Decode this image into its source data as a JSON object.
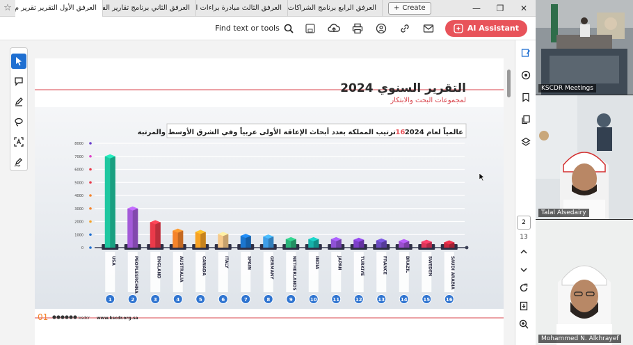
{
  "tabs": [
    {
      "label": "العرفق الأول التقرير تقرير م..",
      "active": true
    },
    {
      "label": "العرفق الثاني برنامج تقارير الفجوات..",
      "active": false
    },
    {
      "label": "العرفق الثالث مبادرة براءات الاخترا..",
      "active": false
    },
    {
      "label": "العرفق الرابع برنامج الشراكات العا..",
      "active": false
    }
  ],
  "create_label": "Create",
  "toolbar": {
    "find_label": "Find text or tools",
    "ai_label": "AI Assistant"
  },
  "page_control": {
    "current": "2",
    "total": "13"
  },
  "report": {
    "title": "التقرير السنوي 2024",
    "subtitle": "لمجموعات البحث والابتكار",
    "chart_heading": "ترتيب المملكة بعدد أبحاث الإعاقة الأولى عربياً وفي الشرق الأوسط والمرتبة",
    "rank_highlight": "16",
    "heading_suffix": "عالمياً لعام 2024",
    "page_num": "01",
    "footer_handle": "ksdcr",
    "footer_site": "www.kscdr.org.sa"
  },
  "chart_data": {
    "type": "bar",
    "categories": [
      "USA",
      "PEOPLESRCHNA",
      "ENGLAND",
      "AUSTRALIA",
      "CANADA",
      "ITALY",
      "SPAIN",
      "GERMANY",
      "NETHERLANDS",
      "INDIA",
      "JAPAN",
      "TURKIYE",
      "FRANCE",
      "BRAZIL",
      "SWEDEN",
      "SAUDI ARABIA"
    ],
    "ranks": [
      "1",
      "2",
      "3",
      "4",
      "5",
      "6",
      "7",
      "8",
      "9",
      "10",
      "11",
      "12",
      "13",
      "14",
      "15",
      "16"
    ],
    "values": [
      7000,
      3000,
      1950,
      1300,
      1200,
      1050,
      900,
      850,
      650,
      650,
      650,
      600,
      550,
      500,
      450,
      400
    ],
    "yticks": [
      "0",
      "1000",
      "2000",
      "3000",
      "4000",
      "5000",
      "6000",
      "7000",
      "8000"
    ],
    "ylim": [
      0,
      8000
    ],
    "colors": [
      "#1fc7a0",
      "#a35ad8",
      "#ea3a4a",
      "#f5832a",
      "#f7a224",
      "#f7c98a",
      "#1c76cf",
      "#3f9ee8",
      "#2bb37a",
      "#17b2aa",
      "#8f52d6",
      "#7d3fc9",
      "#6a4bbf",
      "#9b4fd0",
      "#e0355a",
      "#c8283f"
    ],
    "tick_dot_colors": [
      "#1f6fd1",
      "#1f6fd1",
      "#f7a224",
      "#f5832a",
      "#f5832a",
      "#ea3a4a",
      "#ea3a4a",
      "#e040c8",
      "#6a3dcc"
    ]
  },
  "participants": [
    {
      "name": "KSCDR Meetings"
    },
    {
      "name": "Talal Alsedairy"
    },
    {
      "name": "Mohammed N. Alkhrayef"
    }
  ]
}
